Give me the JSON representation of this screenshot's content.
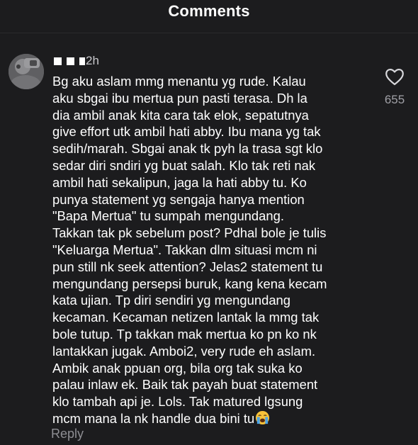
{
  "header": {
    "title": "Comments"
  },
  "comment": {
    "time": "2h",
    "text": "Bg aku aslam mmg menantu yg rude. Kalau\naku sbgai ibu mertua pun pasti terasa. Dh la\ndia ambil anak kita cara tak elok, sepatutnya\ngive effort utk ambil hati abby. Ibu mana yg tak\nsedih/marah. Sbgai anak tk pyh la trasa sgt klo\nsedar diri sndiri yg buat salah. Klo tak reti nak\nambil hati sekalipun, jaga la hati abby tu. Ko\npunya statement yg sengaja hanya mention\n\"Bapa Mertua\" tu sumpah mengundang.\nTakkan tak pk sebelum post? Pdhal bole je tulis\n\"Keluarga Mertua\". Takkan dlm situasi mcm ni\npun still nk seek attention? Jelas2 statement tu\nmengundang persepsi buruk, kang kena kecam\nkata ujian. Tp diri sendiri yg mengundang\nkecaman. Kecaman netizen lantak la mmg tak\nbole tutup. Tp takkan mak mertua ko pn ko nk\nlantakkan jugak. Amboi2, very rude eh aslam.\nAmbik anak ppuan org, bila org tak suka ko\npalau inlaw ek. Baik tak payah buat statement\nklo tambah api je. Lols. Tak matured lgsung\nmcm mana la nk handle dua bini tu",
    "emoji": "loudly-crying-face",
    "likes": "655",
    "reply_label": "Reply"
  },
  "colors": {
    "background": "#1c1c1e",
    "text": "#ffffff",
    "muted": "#8e8e93"
  }
}
